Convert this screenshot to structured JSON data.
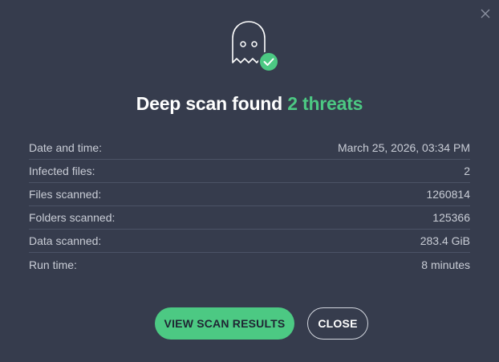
{
  "title": {
    "prefix": "Deep scan found ",
    "highlight": "2 threats"
  },
  "details": [
    {
      "label": "Date and time:",
      "value": "March 25, 2026, 03:34 PM"
    },
    {
      "label": "Infected files:",
      "value": "2"
    },
    {
      "label": "Files scanned:",
      "value": "1260814"
    },
    {
      "label": "Folders scanned:",
      "value": "125366"
    },
    {
      "label": "Data scanned:",
      "value": "283.4 GiB"
    },
    {
      "label": "Run time:",
      "value": "8 minutes"
    }
  ],
  "buttons": {
    "view_results": "VIEW SCAN RESULTS",
    "close": "CLOSE"
  },
  "icons": {
    "close": "close-icon",
    "ghost": "ghost-icon",
    "check": "check-badge-icon"
  },
  "colors": {
    "background": "#363c4d",
    "accent": "#4cc983",
    "text": "#c9cdd6",
    "divider": "#4c5366"
  }
}
